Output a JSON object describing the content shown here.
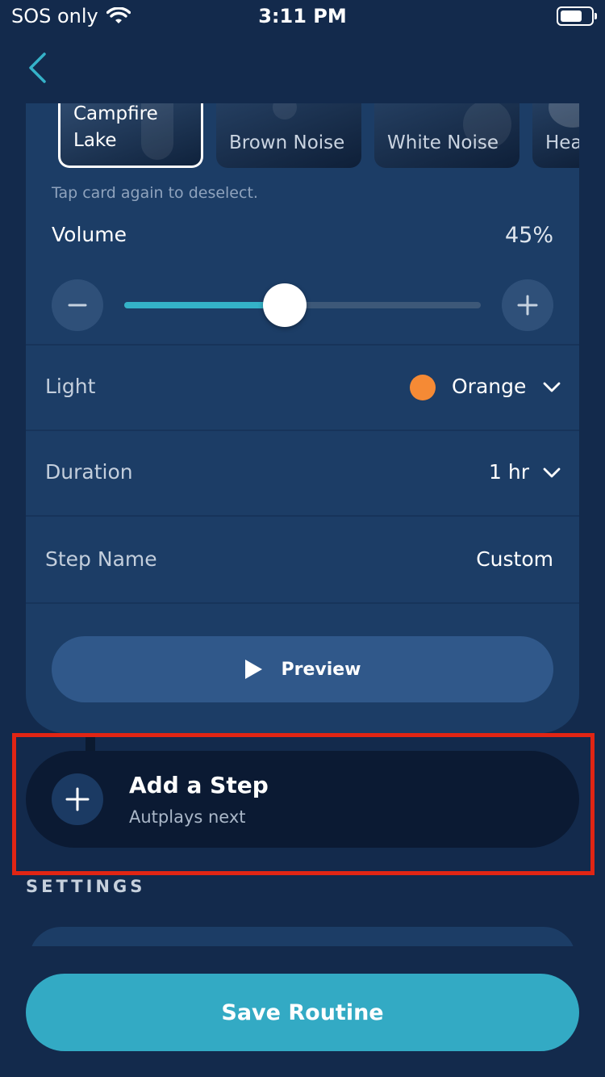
{
  "status_bar": {
    "carrier": "SOS only",
    "time": "3:11 PM"
  },
  "sounds": {
    "items": [
      {
        "label": "Campfire\nLake",
        "selected": true
      },
      {
        "label": "Brown Noise",
        "selected": false
      },
      {
        "label": "White Noise",
        "selected": false
      },
      {
        "label": "Hea",
        "selected": false
      }
    ],
    "hint": "Tap card again to deselect."
  },
  "volume": {
    "label": "Volume",
    "value_text": "45%",
    "value": 45
  },
  "light": {
    "label": "Light",
    "value": "Orange",
    "color": "#f58a35"
  },
  "duration": {
    "label": "Duration",
    "value": "1 hr"
  },
  "step_name": {
    "label": "Step Name",
    "value": "Custom"
  },
  "preview": {
    "label": "Preview"
  },
  "add_step": {
    "title": "Add a Step",
    "subtitle": "Autplays next"
  },
  "settings": {
    "title": "SETTINGS"
  },
  "save": {
    "label": "Save Routine"
  },
  "colors": {
    "accent": "#33aac4",
    "background": "#132a4c",
    "card": "#1c3d66",
    "highlight": "#e12514"
  }
}
